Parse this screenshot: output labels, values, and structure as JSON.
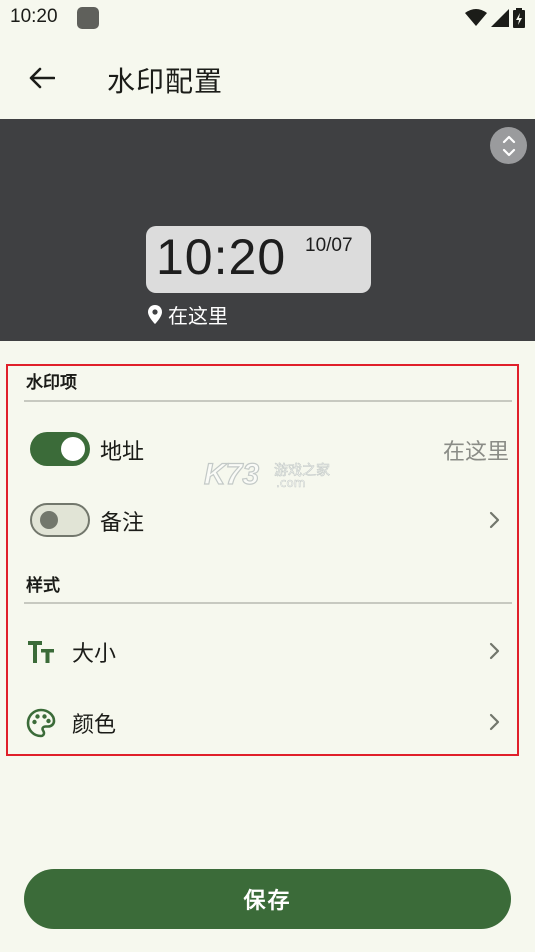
{
  "status_bar": {
    "time": "10:20"
  },
  "app_bar": {
    "title": "水印配置"
  },
  "preview": {
    "time": "10:20",
    "date": "10/07",
    "location": "在这里"
  },
  "sections": {
    "watermark_items": {
      "title": "水印项",
      "address": {
        "label": "地址",
        "value": "在这里",
        "enabled": true
      },
      "note": {
        "label": "备注",
        "enabled": false
      }
    },
    "style": {
      "title": "样式",
      "size": {
        "label": "大小",
        "icon": "text-size-icon"
      },
      "color": {
        "label": "颜色",
        "icon": "palette-icon"
      }
    }
  },
  "overlay_logo": {
    "text": "K73",
    "sub": "游戏之家",
    "domain": ".com"
  },
  "save_button": {
    "label": "保存"
  },
  "colors": {
    "accent": "#3b6b39",
    "background": "#f6f8ee",
    "preview_bg": "#3f4042",
    "highlight_border": "#e0202a"
  }
}
